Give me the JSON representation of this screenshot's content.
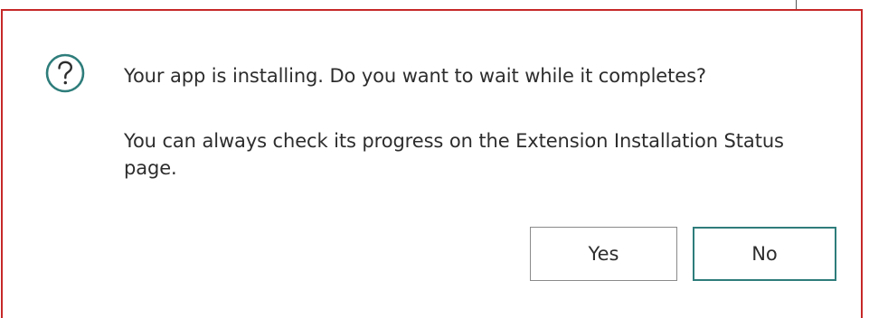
{
  "dialog": {
    "icon": "question-icon",
    "message": "Your app is installing. Do you want to wait while it completes?",
    "detail": "You can always check its progress on the Extension Installation Status page.",
    "buttons": {
      "yes_label": "Yes",
      "no_label": "No"
    }
  },
  "colors": {
    "dialog_border": "#c62828",
    "icon": "#2e7d7b",
    "default_button_border": "#2e7d7b",
    "button_border": "#8a8a8a",
    "text": "#2d2d2d"
  }
}
